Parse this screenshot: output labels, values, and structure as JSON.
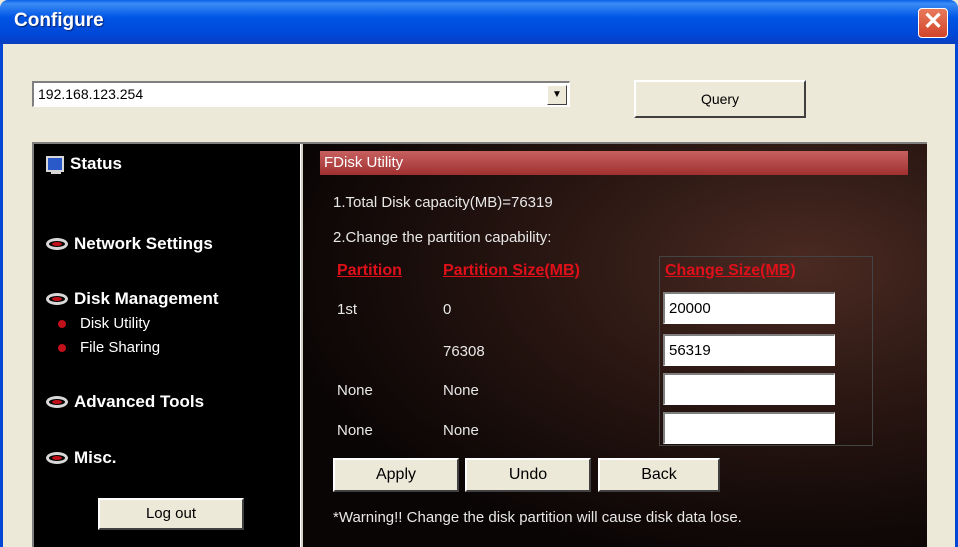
{
  "window": {
    "title": "Configure",
    "close_label": "✕"
  },
  "address": {
    "value": "192.168.123.254",
    "arrow": "▼",
    "query_label": "Query"
  },
  "sidebar": {
    "status": "Status",
    "network": "Network Settings",
    "disk": "Disk Management",
    "disk_utility": "Disk Utility",
    "file_sharing": "File Sharing",
    "advanced": "Advanced Tools",
    "misc": "Misc.",
    "logout": "Log out"
  },
  "fdisk": {
    "title": "FDisk Utility",
    "total_capacity": "1.Total Disk capacity(MB)=76319",
    "change_caption": "2.Change the partition capability:",
    "headers": {
      "partition": "Partition",
      "size": "Partition Size(MB)",
      "change": "Change Size(MB)"
    },
    "rows": [
      {
        "partition": "1st",
        "size": "0",
        "change": "20000"
      },
      {
        "partition": "",
        "size": "76308",
        "change": "56319"
      },
      {
        "partition": "None",
        "size": "None",
        "change": ""
      },
      {
        "partition": "None",
        "size": "None",
        "change": ""
      }
    ],
    "apply": "Apply",
    "undo": "Undo",
    "back": "Back",
    "warning": "*Warning!! Change the disk partition will cause disk data lose."
  },
  "colors": {
    "titlebar": "#0055e5",
    "accent_red": "#e0101a",
    "header_bar": "#b04040"
  }
}
